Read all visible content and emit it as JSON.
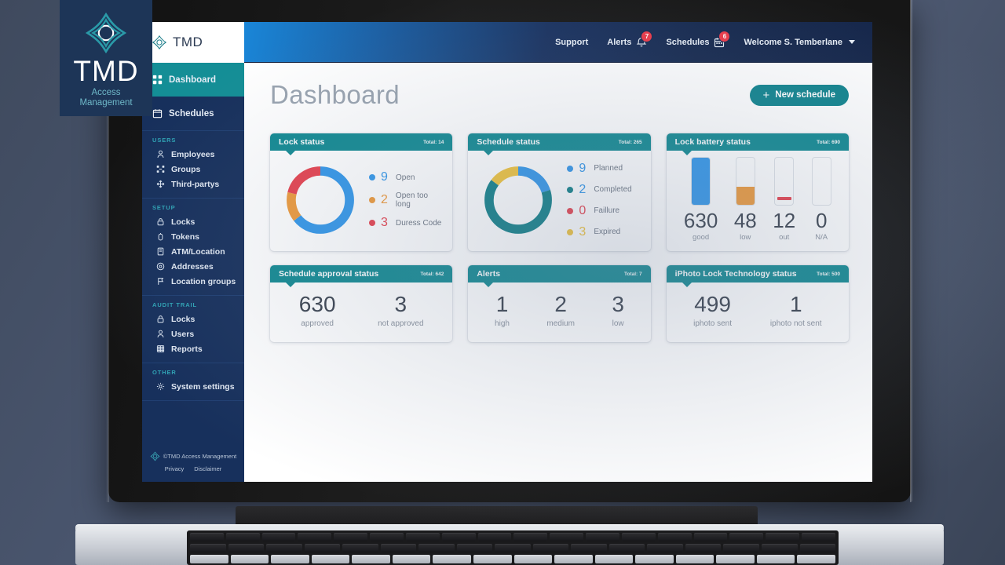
{
  "watermark": {
    "brand": "TMD",
    "line1": "Access",
    "line2": "Management"
  },
  "sidebar": {
    "brand": "TMD",
    "primary": [
      {
        "label": "Dashboard",
        "icon": "grid-icon",
        "active": true
      },
      {
        "label": "Schedules",
        "icon": "calendar-icon",
        "active": false
      }
    ],
    "groups": [
      {
        "title": "USERS",
        "items": [
          {
            "label": "Employees",
            "icon": "user-icon"
          },
          {
            "label": "Groups",
            "icon": "groups-icon"
          },
          {
            "label": "Third-partys",
            "icon": "move-icon"
          }
        ]
      },
      {
        "title": "SETUP",
        "items": [
          {
            "label": "Locks",
            "icon": "lock-icon"
          },
          {
            "label": "Tokens",
            "icon": "token-icon"
          },
          {
            "label": "ATM/Location",
            "icon": "atm-icon"
          },
          {
            "label": "Addresses",
            "icon": "pin-icon"
          },
          {
            "label": "Location groups",
            "icon": "flag-icon"
          }
        ]
      },
      {
        "title": "AUDIT TRAIL",
        "items": [
          {
            "label": "Locks",
            "icon": "lock-icon"
          },
          {
            "label": "Users",
            "icon": "user-icon"
          },
          {
            "label": "Reports",
            "icon": "report-icon"
          }
        ]
      },
      {
        "title": "OTHER",
        "items": [
          {
            "label": "System settings",
            "icon": "gear-icon"
          }
        ]
      }
    ],
    "footer": {
      "copyright": "©TMD Access Management",
      "privacy": "Privacy",
      "disclaimer": "Disclaimer"
    }
  },
  "topbar": {
    "support": "Support",
    "alerts": "Alerts",
    "alerts_badge": "7",
    "schedules": "Schedules",
    "schedules_badge": "6",
    "welcome": "Welcome S. Temberlane"
  },
  "page": {
    "title": "Dashboard",
    "new_schedule": "New schedule",
    "plus": "+"
  },
  "colors": {
    "teal": "#138a93",
    "blue": "#3498ea",
    "orange": "#ef9b3c",
    "red": "#e8434f",
    "yellow": "#f2c53d",
    "deep_teal": "#128189",
    "navy": "#17305c"
  },
  "chart_data": [
    {
      "type": "pie",
      "title": "Lock status",
      "total_label": "Total: 14",
      "total": 14,
      "categories": [
        "Open",
        "Open too long",
        "Duress Code"
      ],
      "values": [
        9,
        2,
        3
      ],
      "colors": [
        "#3498ea",
        "#ef9b3c",
        "#e8434f"
      ],
      "legend": "right",
      "donut": true
    },
    {
      "type": "pie",
      "title": "Schedule status",
      "total_label": "Total: 265",
      "total": 265,
      "categories": [
        "Planned",
        "Completed",
        "Faillure",
        "Expired"
      ],
      "values": [
        9,
        2,
        0,
        3
      ],
      "arc_fractions": [
        0.2,
        0.65,
        0.0,
        0.15
      ],
      "colors": [
        "#3498ea",
        "#128189",
        "#e8434f",
        "#f2c53d"
      ],
      "legend": "right",
      "donut": true
    },
    {
      "type": "bar",
      "title": "Lock battery status",
      "total_label": "Total: 690",
      "total": 690,
      "categories": [
        "good",
        "low",
        "out",
        "N/A"
      ],
      "values": [
        630,
        48,
        12,
        0
      ],
      "fill_percent": [
        100,
        38,
        5,
        0
      ],
      "colors": [
        "#3498ea",
        "#ef9b3c",
        "#e8434f",
        "#ffffff"
      ],
      "ylabel": "",
      "xlabel": ""
    },
    {
      "type": "table",
      "title": "Schedule approval status",
      "total_label": "Total: 642",
      "total": 642,
      "categories": [
        "approved",
        "not approved"
      ],
      "values": [
        630,
        3
      ]
    },
    {
      "type": "table",
      "title": "Alerts",
      "total_label": "Total: 7",
      "total": 7,
      "categories": [
        "high",
        "medium",
        "low"
      ],
      "values": [
        1,
        2,
        3
      ]
    },
    {
      "type": "table",
      "title": "iPhoto Lock Technology status",
      "total_label": "Total: 500",
      "total": 500,
      "categories": [
        "iphoto sent",
        "iphoto not sent"
      ],
      "values": [
        499,
        1
      ]
    }
  ]
}
